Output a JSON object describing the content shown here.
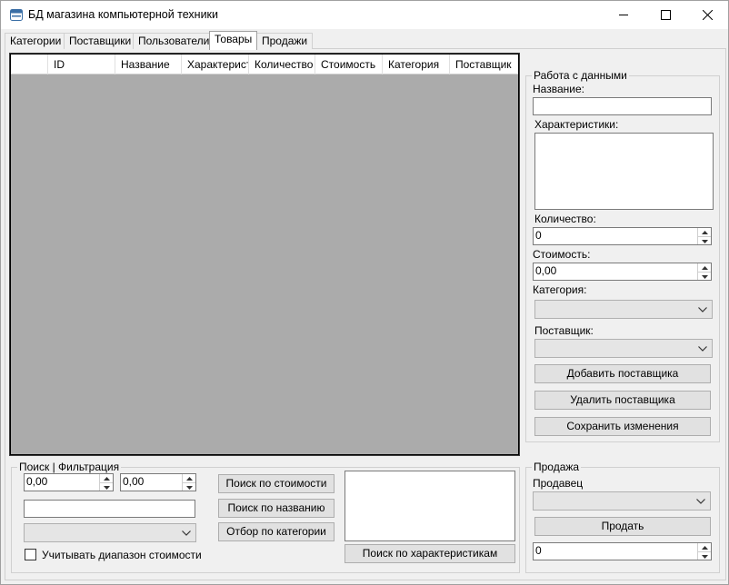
{
  "window": {
    "title": "БД магазина компьютерной техники"
  },
  "tabs": [
    "Категории",
    "Поставщики",
    "Пользователи",
    "Товары",
    "Продажи"
  ],
  "active_tab": "Товары",
  "grid": {
    "columns": [
      "ID",
      "Название",
      "Характерист",
      "Количество",
      "Стоимость",
      "Категория",
      "Поставщик"
    ]
  },
  "data_panel": {
    "legend": "Работа с данными",
    "name_label": "Название:",
    "name_value": "",
    "characteristics_label": "Характеристики:",
    "quantity_label": "Количество:",
    "quantity_value": "0",
    "price_label": "Стоимость:",
    "price_value": "0,00",
    "category_label": "Категория:",
    "supplier_label": "Поставщик:",
    "add_supplier_button": "Добавить поставщика",
    "remove_supplier_button": "Удалить поставщика",
    "save_button": "Сохранить изменения"
  },
  "search_panel": {
    "legend": "Поиск | Фильтрация",
    "price_from": "0,00",
    "price_to": "0,00",
    "search_by_price_button": "Поиск по стоимости",
    "search_by_name_button": "Поиск по названию",
    "filter_by_category_button": "Отбор по категории",
    "search_by_characteristics_button": "Поиск по характеристикам",
    "use_price_range_label": "Учитывать диапазон стоимости"
  },
  "sale_panel": {
    "legend": "Продажа",
    "seller_label": "Продавец",
    "sell_button": "Продать",
    "quantity_value": "0"
  }
}
